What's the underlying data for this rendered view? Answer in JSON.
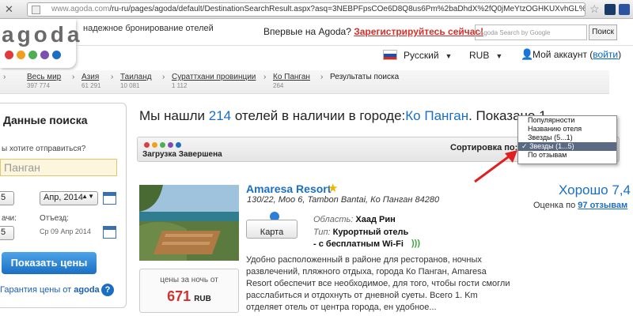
{
  "browser": {
    "url_scheme": "www.agoda.com",
    "url_path": "/ru-ru/pages/agoda/default/DestinationSearchResult.aspx?asq=3NEBPFpsCOe6D8Q8us6Pm%2baDhdX%2fQ0jMeYtzOGHKUXvhGL%2b7ciejyNKb5X92IXRQ..."
  },
  "header": {
    "logo": "agoda",
    "logo_dots": [
      "#e03a3a",
      "#f0a020",
      "#4caf50",
      "#7a4fb0",
      "#1a6fc4"
    ],
    "tagline": "надежное бронирование отелей",
    "first_time": "Впервые на Agoda?",
    "register": "Зарегистрируйтесь сейчас!",
    "search_placeholder": "Agoda Search by Google",
    "search_button": "Поиск",
    "language": "Русский",
    "currency": "RUB",
    "account": "Мой аккаунт",
    "login": "войти"
  },
  "breadcrumbs": [
    {
      "label": "Весь мир",
      "count": "397 774"
    },
    {
      "label": "Азия",
      "count": "61 291"
    },
    {
      "label": "Таиланд",
      "count": "10 081"
    },
    {
      "label": "Сураттхани провинции",
      "count": "1 112"
    },
    {
      "label": "Ко Панган",
      "count": "264"
    },
    {
      "label": "Результаты поиска",
      "count": ""
    }
  ],
  "sidebar": {
    "title": "Данные поиска",
    "where_label": "ы хотите отправиться?",
    "destination": "Панган",
    "checkin_day": "5",
    "checkin_month": "Апр, 2014",
    "checkin_label": "ачи:",
    "checkout_label": "Отъезд:",
    "checkout_day": "5",
    "checkout_date": "Ср 09 Апр 2014",
    "show_prices": "Показать цены",
    "guarantee": "Гарантия цены от",
    "guarantee_brand": "agoda",
    "help": "?"
  },
  "results": {
    "found_prefix": "Мы нашли",
    "count": "214",
    "found_mid": "отелей в наличии в городе:",
    "city": "Ко Панган",
    "shown": ". Показано 1",
    "loading_dots": [
      "#d94040",
      "#f0a020",
      "#4caf50",
      "#7a4fb0",
      "#1a6fc4"
    ],
    "load_status": "Загрузка Завершена",
    "sort_label": "Сортировка по:",
    "sort_options": [
      "Популярности",
      "Названию отеля",
      "Звезды (5...1)",
      "Звезды (1...5)",
      "По отзывам"
    ],
    "sort_selected_mark": "✓"
  },
  "hotel": {
    "name": "Amaresa Resort",
    "address": "130/22, Moo 6, Tambon Bantai, Ко Панган 84280",
    "map_label": "Карта",
    "area_label": "Область:",
    "area": "Хаад Рин",
    "type_label": "Тип:",
    "type": "Курортный отель",
    "wifi": "- с бесплатным Wi-Fi",
    "description": "Удобно расположенный в районе для ресторанов, ночных развлечений, пляжного отдыха, города Ко Панган, Amaresa Resort обеспечит все необходимое, для того, чтобы гости смогли расслабиться и отдохнуть от дневной суеты. Всего 1. Km отделяет отель от центра города, ен удобное...",
    "price_label": "цены за ночь от",
    "price": "671",
    "price_currency": "RUB",
    "rating_text": "Хорошо 7,4",
    "reviews_prefix": "Оценка по",
    "reviews_link": "97 отзывам"
  }
}
